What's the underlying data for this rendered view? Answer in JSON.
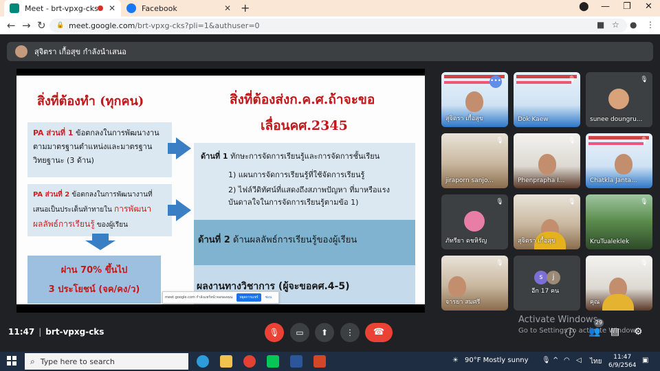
{
  "browser": {
    "tabs": [
      {
        "title": "Meet - brt-vpxg-cks",
        "favicon_color": "#00897b",
        "recording": true,
        "active": true
      },
      {
        "title": "Facebook",
        "favicon_color": "#1877f2",
        "recording": false,
        "active": false
      }
    ],
    "new_tab_glyph": "+",
    "close_glyph": "✕",
    "url_host": "meet.google.com",
    "url_path": "/brt-vpxg-cks?pli=1&authuser=0",
    "window_controls": [
      "—",
      "❐",
      "✕"
    ]
  },
  "presenter_bar": {
    "text": "สุจิตรา เกื้อสุข กำลังนำเสนอ"
  },
  "slide": {
    "left_title": "สิ่งที่ต้องทำ (ทุกคน)",
    "right_title_line1": "สิ่งที่ต้องส่งก.ค.ศ.ถ้าจะขอ",
    "right_title_line2": "เลื่อนคศ.2345",
    "pa1_key": "PA ส่วนที่ 1",
    "pa1_text": "ข้อตกลงในการพัฒนางานตามมาตรฐานตำแหน่งและมาตรฐานวิทยฐานะ (3 ด้าน)",
    "pa2_key": "PA ส่วนที่ 2",
    "pa2_text1": "ข้อตกลงในการพัฒนางานที่เสนอเป็นประเด็นท้าทายใน",
    "pa2_highlight": "การพัฒนาผลลัพธ์การเรียนรู้",
    "pa2_text2": "ของผู้เรียน",
    "pass_line1": "ผ่าน 70% ขึ้นไป",
    "pass_line2": "3 ประโยชน์ (จค/คง/ว)",
    "dim1_key": "ด้านที่ 1",
    "dim1_text": "ทักษะการจัดการเรียนรู้และการจัดการชั้นเรียน",
    "dim1_item1": "1) แผนการจัดการเรียนรู้ที่ใช้จัดการเรียนรู้",
    "dim1_item2": "2) ไฟล์วีดิทัศน์ที่แสดงถึงสภาพปัญหา ที่มาหรือแรงบันดาลใจในการจัดการเรียนรู้ตามข้อ 1)",
    "dim2_key": "ด้านที่ 2",
    "dim2_text": "ด้านผลลัพธ์การเรียนรู้ของผู้เรียน",
    "dim3_text": "ผลงานทางวิชาการ (ผู้จะขอคศ.4-5)",
    "share_popup_text": "meet.google.com กำลังแชร์หน้าจอของคุณ",
    "share_popup_stop": "หยุดการแชร์",
    "share_popup_hide": "ซ่อน"
  },
  "participants": [
    {
      "name": "สุจิตรา เกื้อสุข",
      "type": "slide",
      "muted": false,
      "menu": true
    },
    {
      "name": "Dok Kaew",
      "type": "slide",
      "muted": true
    },
    {
      "name": "sunee doungru...",
      "type": "avatar",
      "muted": true
    },
    {
      "name": "jiraporn sanjo...",
      "type": "room",
      "muted": true
    },
    {
      "name": "Phenprapha I...",
      "type": "room2",
      "muted": true
    },
    {
      "name": "Chatkla Janta...",
      "type": "slide",
      "muted": true
    },
    {
      "name": "ภัทรียา ดชหิรัญ",
      "type": "avatar",
      "muted": true
    },
    {
      "name": "สุจิตรา เกื้อสุข",
      "type": "room",
      "muted": true
    },
    {
      "name": "KruTualeklek",
      "type": "outdoor",
      "muted": true
    },
    {
      "name": "จารยา สมศรี",
      "type": "room",
      "muted": true
    },
    {
      "name": "อีก 17 คน",
      "type": "others",
      "muted": false
    },
    {
      "name": "คุณ",
      "type": "room2",
      "muted": true
    }
  ],
  "others_initials": [
    "s",
    "j"
  ],
  "bottom": {
    "time": "11:47",
    "meeting_code": "brt-vpxg-cks",
    "participant_count": "29",
    "activate_title": "Activate Windows",
    "activate_sub": "Go to Settings to activate Windows."
  },
  "taskbar": {
    "search_placeholder": "Type here to search",
    "weather": "90°F  Mostly sunny",
    "lang": "ไทย",
    "time": "11:47",
    "date": "6/9/2564"
  },
  "colors": {
    "meet_bg": "#202124",
    "hangup": "#ea4335",
    "slide_red": "#c0181b",
    "slide_blue": "#3a7fc4"
  }
}
